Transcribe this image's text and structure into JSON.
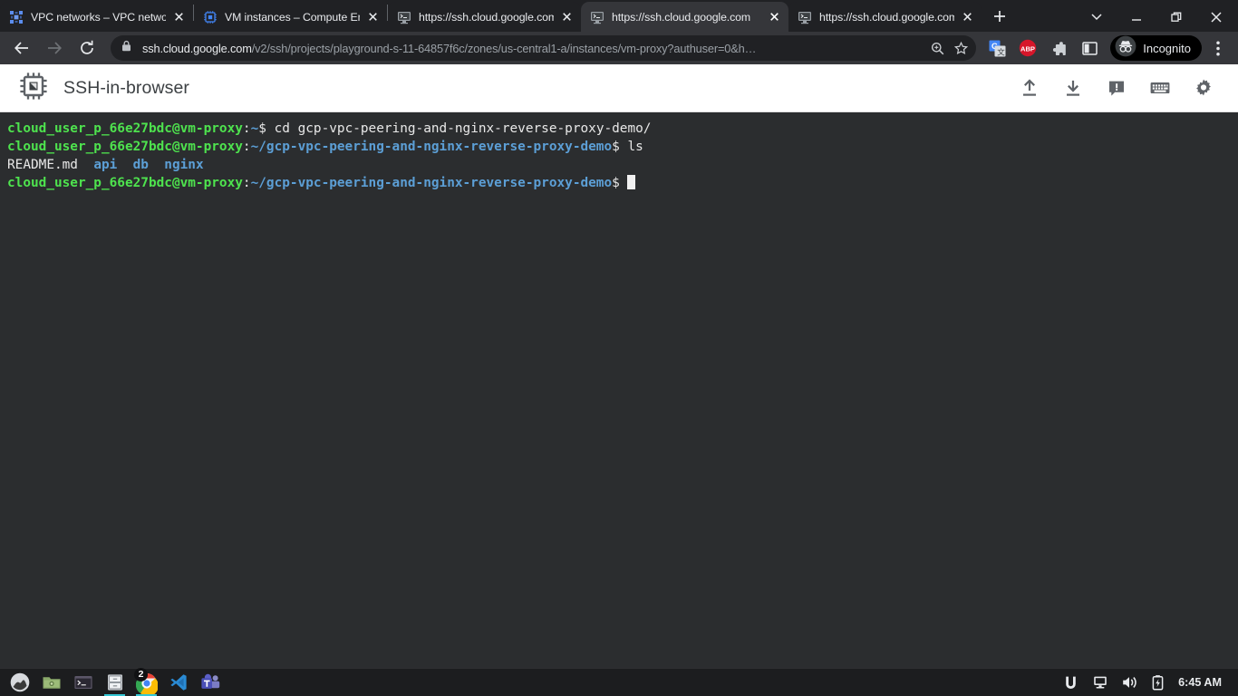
{
  "browser": {
    "tabs": [
      {
        "title": "VPC networks – VPC networks – Compute Engine",
        "favicon": "vpc-network-icon",
        "active": false
      },
      {
        "title": "VM instances – Compute Engine",
        "favicon": "compute-engine-icon",
        "active": false
      },
      {
        "title": "https://ssh.cloud.google.com",
        "favicon": "ssh-console-icon",
        "active": false
      },
      {
        "title": "https://ssh.cloud.google.com",
        "favicon": "ssh-console-icon",
        "active": true
      },
      {
        "title": "https://ssh.cloud.google.com",
        "favicon": "ssh-console-icon",
        "active": false
      }
    ],
    "new_tab_label": "+",
    "window_controls": {
      "tab_search": "tab-search-icon",
      "minimize": "minimize-icon",
      "maximize": "maximize-icon",
      "close": "close-icon"
    },
    "nav": {
      "back": "back-arrow-icon",
      "forward": "forward-arrow-icon",
      "reload": "reload-icon"
    },
    "omnibox": {
      "lock_icon": "lock-icon",
      "host": "ssh.cloud.google.com",
      "path": "/v2/ssh/projects/playground-s-11-64857f6c/zones/us-central1-a/instances/vm-proxy?authuser=0&h…",
      "zoom_icon": "zoom-magnifier-icon",
      "bookmark_icon": "star-icon"
    },
    "extensions": [
      {
        "name": "google-translate-icon"
      },
      {
        "name": "adblock-plus-icon",
        "badge_text": "ABP"
      },
      {
        "name": "extensions-puzzle-icon"
      },
      {
        "name": "sidepanel-icon"
      }
    ],
    "profile": {
      "label": "Incognito",
      "icon": "incognito-icon"
    },
    "menu_icon": "three-dot-menu-icon"
  },
  "app": {
    "logo_icon": "cpu-chip-icon",
    "title": "SSH-in-browser",
    "actions": [
      {
        "name": "upload-file-button",
        "icon": "upload-icon"
      },
      {
        "name": "download-file-button",
        "icon": "download-icon"
      },
      {
        "name": "send-feedback-button",
        "icon": "feedback-icon"
      },
      {
        "name": "keyboard-shortcuts-button",
        "icon": "keyboard-icon"
      },
      {
        "name": "settings-button",
        "icon": "gear-icon"
      }
    ]
  },
  "terminal": {
    "colors": {
      "background": "#2b2d2f",
      "foreground": "#e8e8e8",
      "user_green": "#4ee34e",
      "path_blue": "#5c9fd6",
      "cursor": "#f1f1f1"
    },
    "user_host": "cloud_user_p_66e27bdc@vm-proxy",
    "lines": [
      {
        "type": "prompt",
        "user_host": "cloud_user_p_66e27bdc@vm-proxy",
        "colon": ":",
        "path": "~",
        "dollar": "$ ",
        "command": "cd gcp-vpc-peering-and-nginx-reverse-proxy-demo/"
      },
      {
        "type": "prompt",
        "user_host": "cloud_user_p_66e27bdc@vm-proxy",
        "colon": ":",
        "path": "~/gcp-vpc-peering-and-nginx-reverse-proxy-demo",
        "dollar": "$ ",
        "command": "ls"
      },
      {
        "type": "output",
        "entries": [
          {
            "name": "README.md",
            "kind": "file"
          },
          {
            "name": "api",
            "kind": "dir"
          },
          {
            "name": "db",
            "kind": "dir"
          },
          {
            "name": "nginx",
            "kind": "dir"
          }
        ]
      },
      {
        "type": "prompt",
        "user_host": "cloud_user_p_66e27bdc@vm-proxy",
        "colon": ":",
        "path": "~/gcp-vpc-peering-and-nginx-reverse-proxy-demo",
        "dollar": "$ ",
        "command": "",
        "cursor": true
      }
    ]
  },
  "taskbar": {
    "items": [
      {
        "name": "taskbar-menu-button",
        "icon": "linux-mint-menu-icon"
      },
      {
        "name": "taskbar-file-manager",
        "icon": "file-manager-icon"
      },
      {
        "name": "taskbar-terminal",
        "icon": "terminal-icon"
      },
      {
        "name": "taskbar-archive-manager",
        "icon": "archive-cabinet-icon",
        "active": true
      },
      {
        "name": "taskbar-chrome",
        "icon": "chrome-icon",
        "badge": "2",
        "active": true
      },
      {
        "name": "taskbar-vscode",
        "icon": "vscode-icon"
      },
      {
        "name": "taskbar-teams",
        "icon": "microsoft-teams-icon"
      }
    ],
    "tray": [
      {
        "name": "tray-ubiquiti-icon",
        "icon": "u-logo-icon"
      },
      {
        "name": "tray-display-icon",
        "icon": "monitor-icon"
      },
      {
        "name": "tray-volume-icon",
        "icon": "speaker-icon"
      },
      {
        "name": "tray-battery-icon",
        "icon": "battery-charging-icon"
      }
    ],
    "clock": "6:45 AM"
  }
}
